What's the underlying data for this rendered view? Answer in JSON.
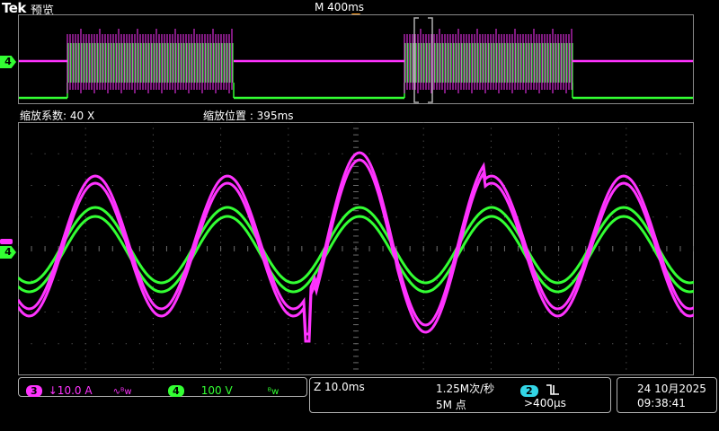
{
  "header": {
    "brand": "Tek",
    "mode": "预览",
    "timebase": "M 400ms"
  },
  "zoom": {
    "factor_label": "缩放系数: 40 X",
    "position_label": "缩放位置 : 395ms"
  },
  "markers": {
    "ch4_overview": "4",
    "ch4_zoom": "4"
  },
  "channels": [
    {
      "id": "3",
      "scale": "↓10.0 A",
      "bw_icon": "bandwidth-limit-icon",
      "color": "#ff33ff"
    },
    {
      "id": "4",
      "scale": "100 V",
      "bw_icon": "bandwidth-limit-icon",
      "color": "#33ff33"
    }
  ],
  "acquisition": {
    "zoom_scale": "Z 10.0ms",
    "sample_rate": "1.25M次/秒",
    "record_length": "5M 点",
    "trigger_source": "2",
    "trigger_icon": "falling-edge-icon",
    "trigger_level": ">400μs"
  },
  "datetime": {
    "date": "24 10月2025",
    "time": "09:38:41"
  },
  "colors": {
    "ch3": "#ff33ff",
    "ch4": "#33ff33",
    "ch2": "#33d6e6",
    "trigger": "#ff9a1a",
    "grid": "#6a6a6a"
  }
}
